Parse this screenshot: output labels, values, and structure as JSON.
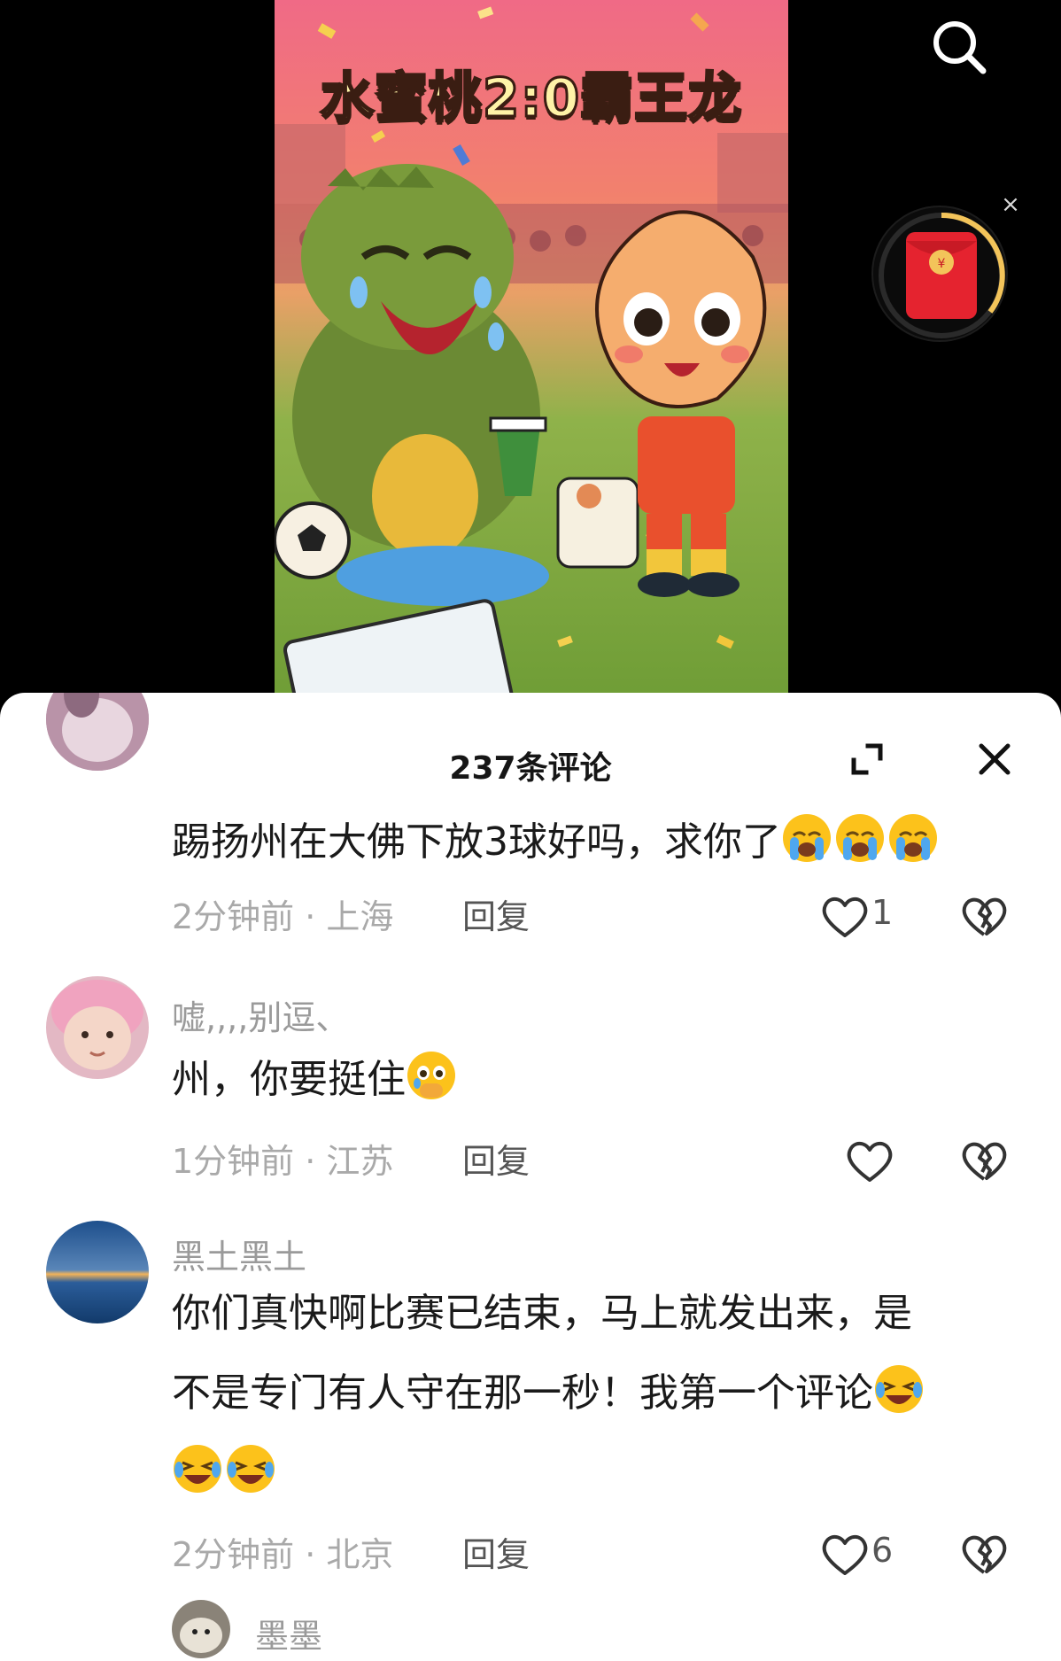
{
  "video": {
    "poster_title": "水蜜桃2:0霸王龙"
  },
  "icons": {
    "search": "search-icon",
    "red_packet": "red-packet-icon",
    "close": "close-icon",
    "expand": "expand-icon",
    "like": "heart-icon",
    "dislike": "broken-heart-icon"
  },
  "sheet": {
    "title": "237条评论"
  },
  "comments": [
    {
      "username": "",
      "text": "踢扬州在大佛下放3球好吗，求你了",
      "emojis": [
        "loudly-crying-emoji",
        "loudly-crying-emoji",
        "loudly-crying-emoji"
      ],
      "time": "2分钟前",
      "location": "上海",
      "meta": "2分钟前 · 上海",
      "reply": "回复",
      "likes": "1"
    },
    {
      "username": "嘘,,,,别逗、",
      "text": "州，你要挺住",
      "emojis": [
        "holding-back-tears-emoji"
      ],
      "time": "1分钟前",
      "location": "江苏",
      "meta": "1分钟前 · 江苏",
      "reply": "回复",
      "likes": ""
    },
    {
      "username": "黑土黑土",
      "text_line1": "你们真快啊比赛已结束，马上就发出来，是",
      "text_line2": "不是专门有人守在那一秒！我第一个评论",
      "emojis": [
        "rolling-laughing-emoji",
        "rolling-laughing-emoji",
        "rolling-laughing-emoji"
      ],
      "time": "2分钟前",
      "location": "北京",
      "meta": "2分钟前 · 北京",
      "reply": "回复",
      "likes": "6"
    },
    {
      "username": "墨墨"
    }
  ],
  "colors": {
    "poster_pink": "#f06a86",
    "poster_grass": "#6f9d36",
    "red_packet": "#e5232f",
    "red_packet_ring": "#f3c45a",
    "text_primary": "#1a1a1a",
    "text_secondary": "#a9a9a9"
  }
}
